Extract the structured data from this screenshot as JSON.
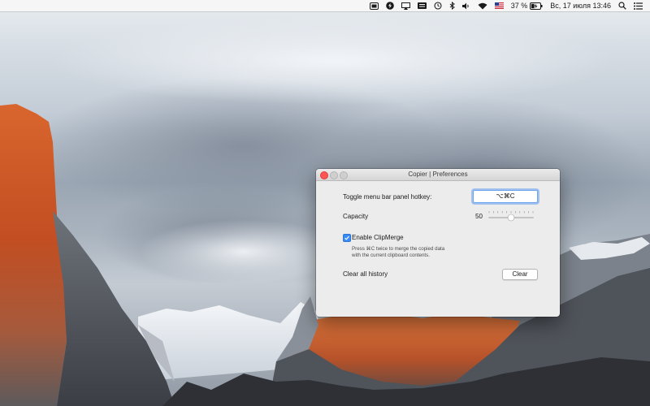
{
  "menubar": {
    "battery_percent": "37 %",
    "datetime": "Вс, 17 июля  13:46",
    "icons": [
      "screen-capture-icon",
      "power-bolt-icon",
      "airplay-icon",
      "keyboard-icon",
      "time-machine-icon",
      "bluetooth-icon",
      "volume-icon",
      "wifi-icon",
      "us-flag-icon",
      "battery-icon",
      "spotlight-search-icon",
      "notification-center-icon"
    ],
    "battery_level": 0.37
  },
  "window": {
    "title": "Copier | Preferences",
    "hotkey_label": "Toggle menu bar panel hotkey:",
    "hotkey_value": "⌥⌘C",
    "capacity_label": "Capacity",
    "capacity_value": "50",
    "capacity_fraction": 0.5,
    "clipmerge_label": "Enable ClipMerge",
    "clipmerge_checked": true,
    "clipmerge_help_line1": "Press ⌘C twice to merge the copied data",
    "clipmerge_help_line2": "with the current clipboard contents.",
    "clear_history_label": "Clear all history",
    "clear_button_label": "Clear"
  },
  "colors": {
    "close": "#fc5753",
    "accent": "#3a8cf5",
    "rock_orange": "#d9652e"
  }
}
